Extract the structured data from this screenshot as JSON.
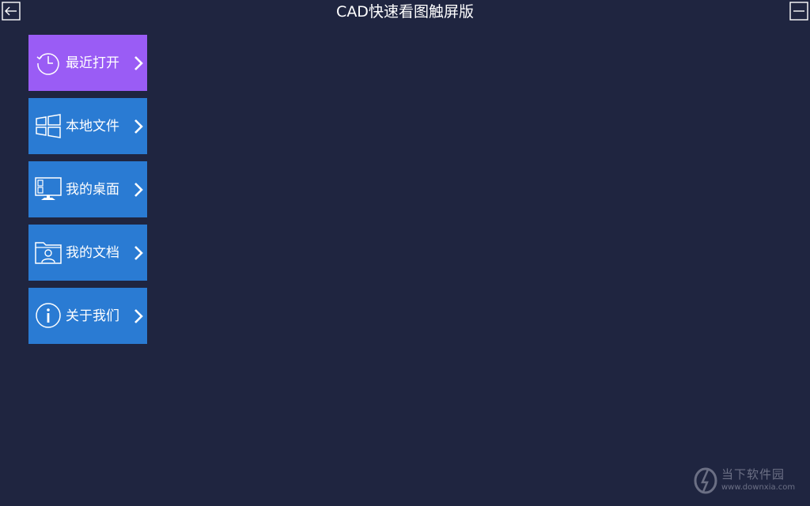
{
  "window": {
    "title": "CAD快速看图触屏版"
  },
  "titlebar": {
    "back_icon": "back-arrow-icon",
    "minimize_icon": "minimize-icon"
  },
  "menu": {
    "items": [
      {
        "label": "最近打开",
        "icon": "history-clock-icon",
        "active": true,
        "color": "#9a5cf5"
      },
      {
        "label": "本地文件",
        "icon": "windows-icon",
        "active": false,
        "color": "#2a7bd3"
      },
      {
        "label": "我的桌面",
        "icon": "desktop-monitor-icon",
        "active": false,
        "color": "#2a7bd3"
      },
      {
        "label": "我的文档",
        "icon": "user-folder-icon",
        "active": false,
        "color": "#2a7bd3"
      },
      {
        "label": "关于我们",
        "icon": "info-icon",
        "active": false,
        "color": "#2a7bd3"
      }
    ]
  },
  "watermark": {
    "name": "当下软件园",
    "url": "www.downxia.com"
  },
  "colors": {
    "background": "#1f2540",
    "accent_active": "#9a5cf5",
    "accent": "#2a7bd3"
  }
}
